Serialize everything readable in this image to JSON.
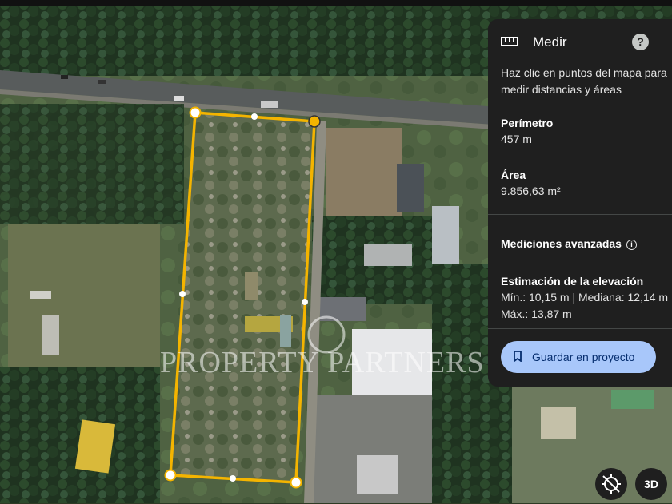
{
  "panel": {
    "title": "Medir",
    "help_label": "?",
    "description": "Haz clic en puntos del mapa para medir distancias y áreas",
    "perimeter_label": "Perímetro",
    "perimeter_value": "457 m",
    "area_label": "Área",
    "area_value": "9.856,63 m²",
    "advanced_label": "Mediciones avanzadas",
    "elevation_label": "Estimación de la elevación",
    "elevation_value": "Mín.: 10,15 m | Mediana: 12,14 m | Máx.: 13,87 m",
    "save_button": "Guardar en proyecto"
  },
  "map_controls": {
    "three_d": "3D"
  },
  "watermark": "PROPERTY PARTNERS ®",
  "colors": {
    "measure_line": "#f4b400",
    "panel_bg": "#1f1f1f",
    "save_button_bg": "#a8c7fa",
    "save_button_text": "#062e6f"
  },
  "icons": [
    "ruler-icon",
    "help-icon",
    "info-icon",
    "bookmark-icon",
    "location-off-icon"
  ]
}
